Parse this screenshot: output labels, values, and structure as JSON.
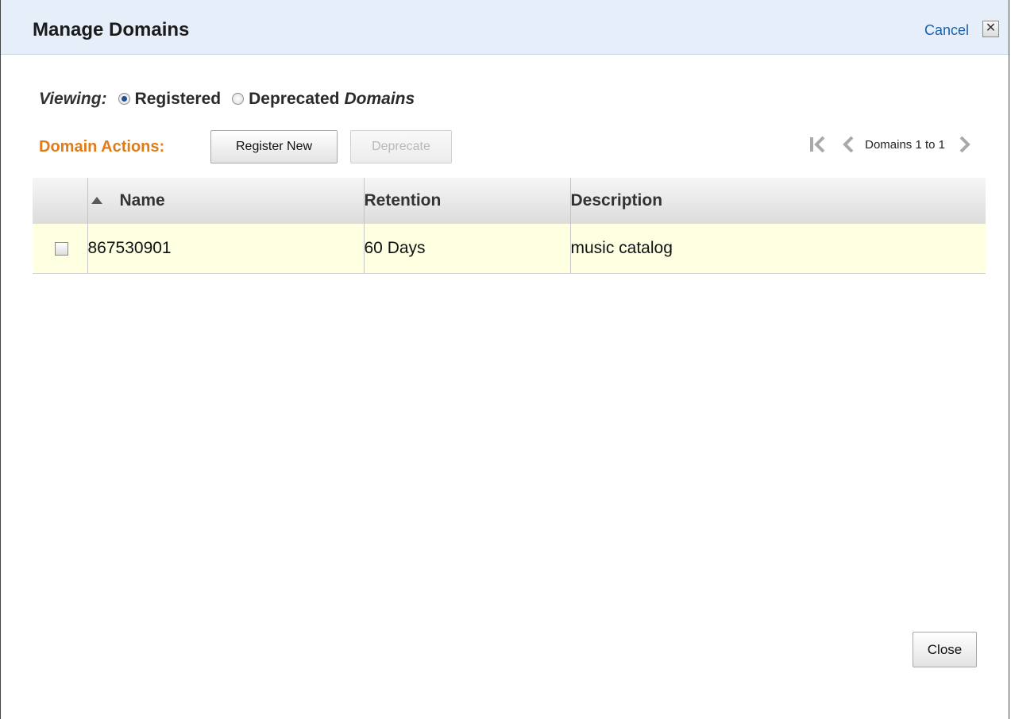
{
  "dialog": {
    "title": "Manage Domains",
    "cancel_label": "Cancel",
    "close_x": "✕"
  },
  "viewing": {
    "label": "Viewing:",
    "options": [
      {
        "label": "Registered",
        "selected": true
      },
      {
        "label": "Deprecated",
        "selected": false
      }
    ],
    "suffix": "Domains"
  },
  "actions": {
    "label": "Domain Actions:",
    "register_label": "Register New",
    "deprecate_label": "Deprecate"
  },
  "pager": {
    "text": "Domains 1 to 1"
  },
  "table": {
    "columns": [
      "Name",
      "Retention",
      "Description"
    ],
    "rows": [
      {
        "checked": false,
        "name": "867530901",
        "retention": "60 Days",
        "description": "music catalog"
      }
    ]
  },
  "footer": {
    "close_label": "Close"
  },
  "colors": {
    "title_bar": "#e6eff9",
    "link": "#1b5fa8",
    "actions_label": "#e07b1a",
    "row_highlight": "#ffffe1"
  }
}
